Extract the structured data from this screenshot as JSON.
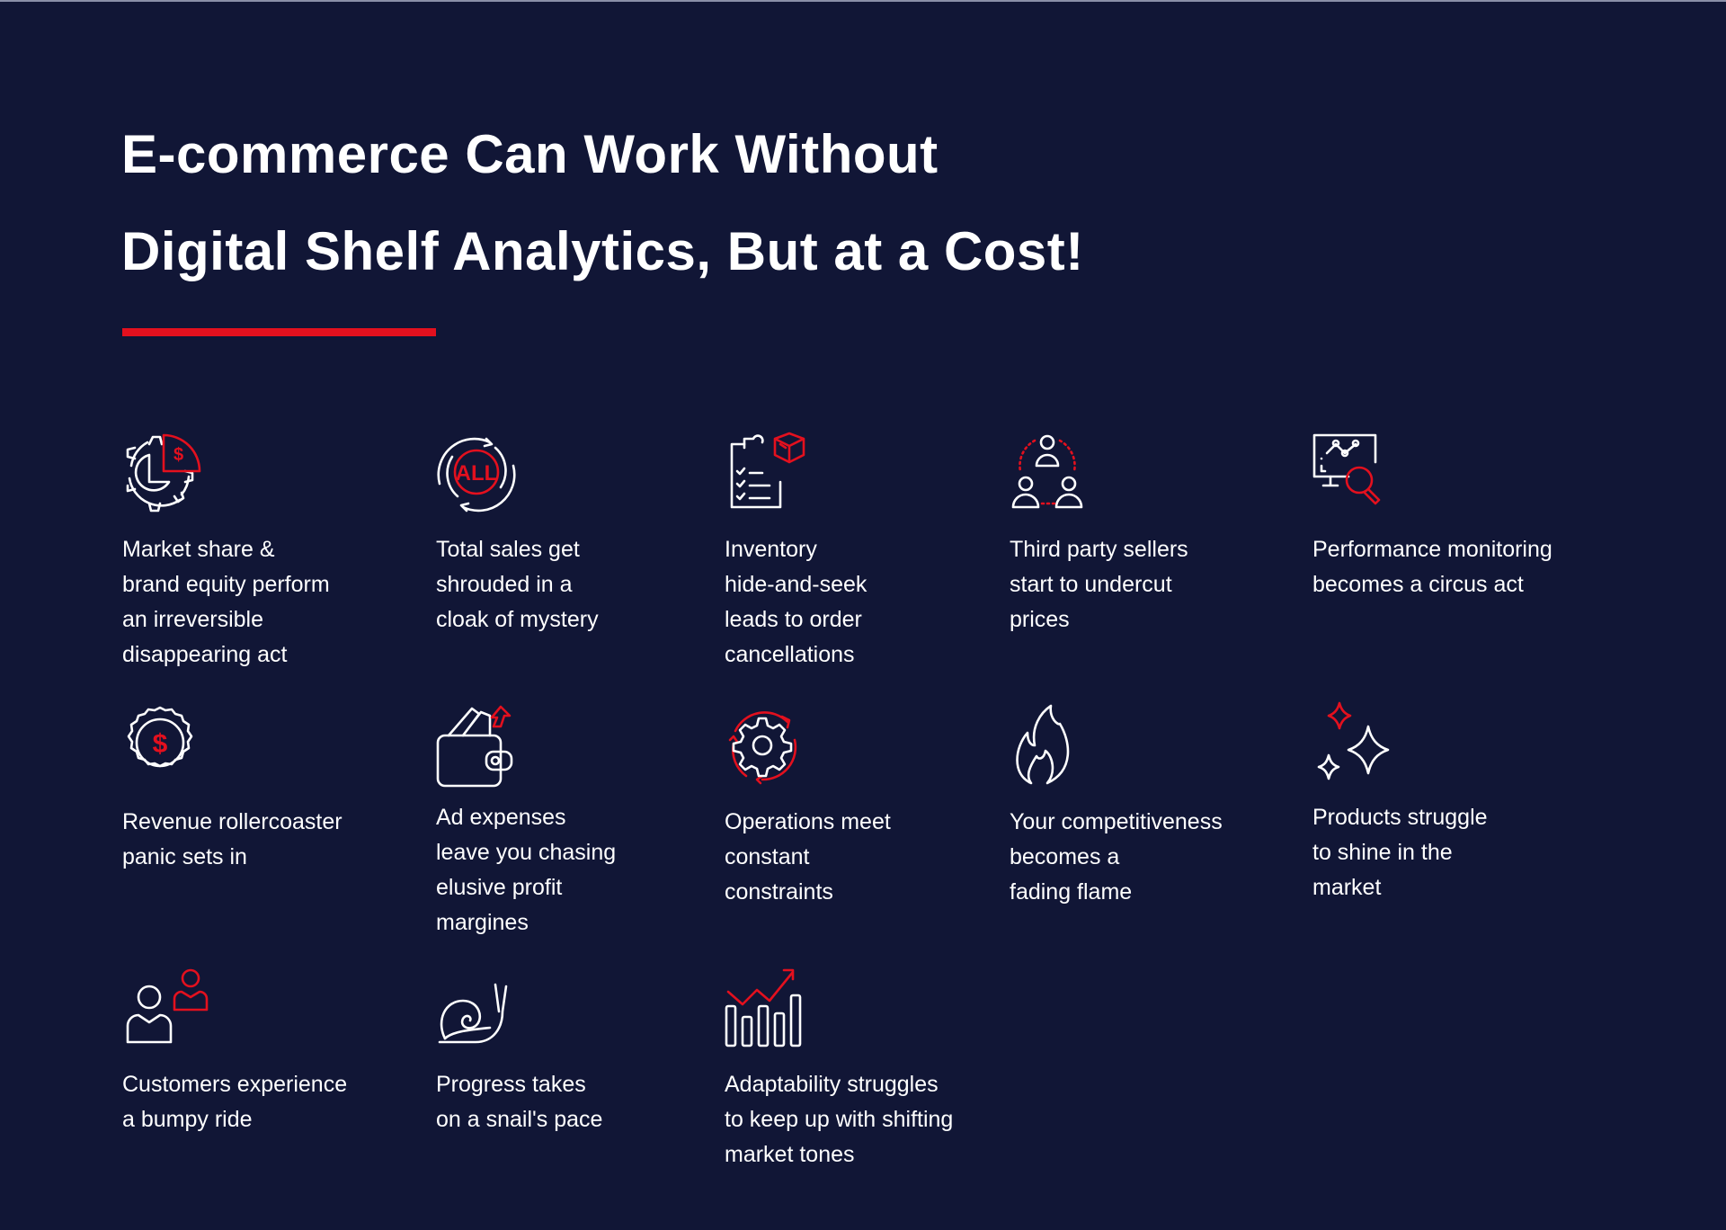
{
  "header": {
    "title_lines": [
      "E-commerce Can Work Without",
      "Digital Shelf Analytics, But at a Cost!"
    ]
  },
  "colors": {
    "background": "#111636",
    "accent": "#e3101e",
    "text": "#ffffff"
  },
  "items": [
    {
      "icon": "gear-pie-chart-dollar-icon",
      "lines": [
        "Market share &",
        "brand equity perform",
        "an irreversible",
        "disappearing act"
      ]
    },
    {
      "icon": "all-circular-arrows-icon",
      "icon_text": "ALL",
      "lines": [
        "Total sales get",
        "shrouded in a",
        "cloak of mystery"
      ]
    },
    {
      "icon": "clipboard-checklist-box-icon",
      "lines": [
        "Inventory",
        "hide-and-seek",
        "leads to order",
        "cancellations"
      ]
    },
    {
      "icon": "three-people-network-icon",
      "lines": [
        "Third party sellers",
        "start to undercut",
        "prices"
      ]
    },
    {
      "icon": "monitor-chart-magnifier-icon",
      "lines": [
        "Performance monitoring",
        "becomes a circus act"
      ]
    },
    {
      "icon": "dollar-badge-icon",
      "icon_text": "$",
      "lines": [
        "Revenue rollercoaster",
        "panic sets in"
      ]
    },
    {
      "icon": "wallet-arrow-up-icon",
      "lines": [
        "Ad expenses",
        "leave you chasing",
        "elusive profit",
        "margines"
      ]
    },
    {
      "icon": "gear-cycle-arrows-icon",
      "lines": [
        "Operations meet",
        "constant",
        "constraints"
      ]
    },
    {
      "icon": "flame-icon",
      "lines": [
        "Your competitiveness",
        "becomes a",
        "fading flame"
      ]
    },
    {
      "icon": "sparkles-icon",
      "lines": [
        "Products struggle",
        "to shine in the",
        "market"
      ]
    },
    {
      "icon": "two-customers-icon",
      "lines": [
        "Customers experience",
        "a bumpy ride"
      ]
    },
    {
      "icon": "snail-icon",
      "lines": [
        "Progress takes",
        "on a snail's pace"
      ]
    },
    {
      "icon": "bar-chart-trend-up-icon",
      "lines": [
        "Adaptability struggles",
        "to keep up with shifting",
        "market tones"
      ]
    }
  ]
}
